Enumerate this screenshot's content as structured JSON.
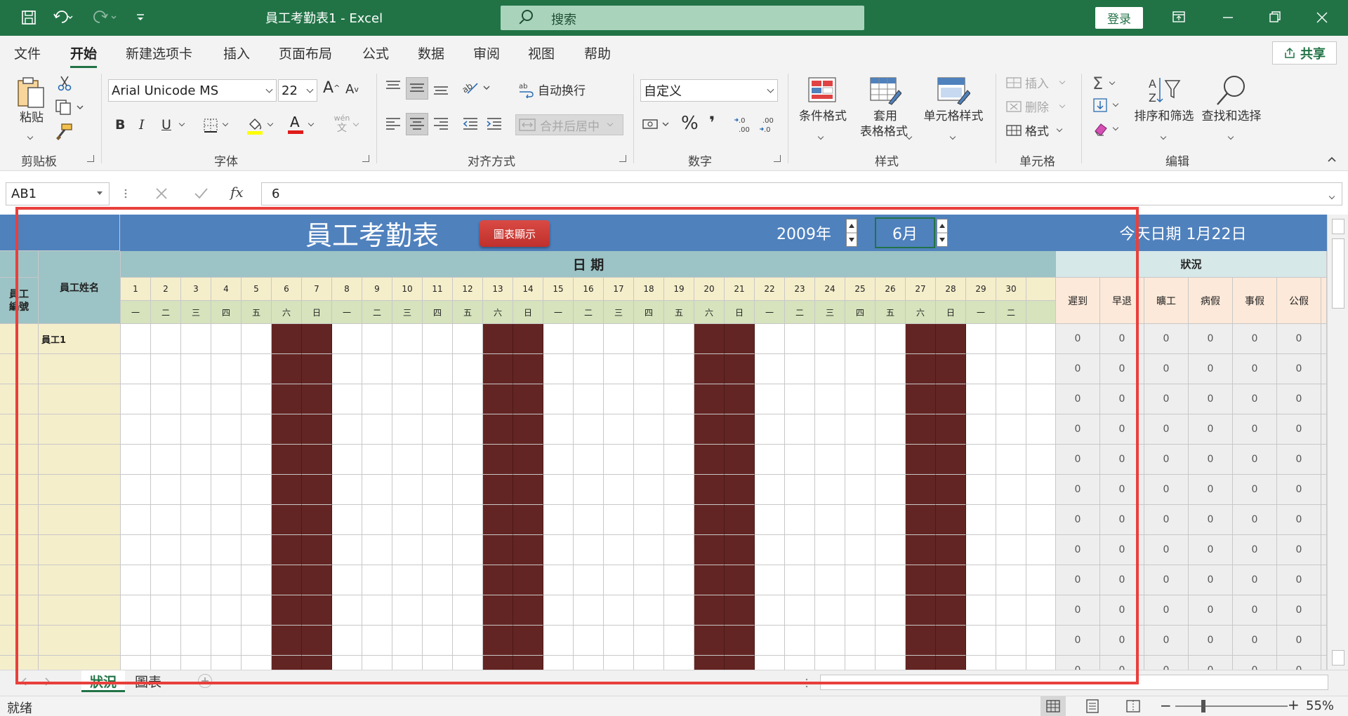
{
  "app": {
    "window_title": "員工考勤表1  -  Excel",
    "search_placeholder": "搜索",
    "login": "登录",
    "share": "共享"
  },
  "tabs": [
    "文件",
    "开始",
    "新建选项卡",
    "插入",
    "页面布局",
    "公式",
    "数据",
    "审阅",
    "视图",
    "帮助"
  ],
  "active_tab": "开始",
  "ribbon": {
    "groups": [
      "剪贴板",
      "字体",
      "对齐方式",
      "数字",
      "样式",
      "单元格",
      "编辑"
    ],
    "paste": "粘贴",
    "font_name": "Arial Unicode MS",
    "font_size": "22",
    "wrap_text": "自动换行",
    "merge_center": "合并后居中",
    "number_format": "自定义",
    "conditional_format": "条件格式",
    "format_table_line1": "套用",
    "format_table_line2": "表格格式",
    "cell_styles": "单元格样式",
    "insert": "插入",
    "delete": "删除",
    "format": "格式",
    "sort_filter": "排序和筛选",
    "find_select": "查找和选择",
    "bold": "B",
    "italic": "I",
    "underline": "U",
    "wen": "wén",
    "wen_sub": "文",
    "percent": "%",
    "comma": "❜"
  },
  "formula_bar": {
    "name_box": "AB1",
    "fx": "fx",
    "value": "6"
  },
  "sheet": {
    "title": "員工考勤表",
    "chart_button": "圖表顯示",
    "year": "2009年",
    "month": "6月",
    "today_label": "今天日期  1月22日",
    "date_header": "日  期",
    "status_header": "狀況",
    "col_emp_id_line1": "員工",
    "col_emp_id_line2": "編號",
    "col_emp_name": "員工姓名",
    "days": [
      "1",
      "2",
      "3",
      "4",
      "5",
      "6",
      "7",
      "8",
      "9",
      "10",
      "11",
      "12",
      "13",
      "14",
      "15",
      "16",
      "17",
      "18",
      "19",
      "20",
      "21",
      "22",
      "23",
      "24",
      "25",
      "26",
      "27",
      "28",
      "29",
      "30"
    ],
    "weekdays": [
      "一",
      "二",
      "三",
      "四",
      "五",
      "六",
      "日",
      "一",
      "二",
      "三",
      "四",
      "五",
      "六",
      "日",
      "一",
      "二",
      "三",
      "四",
      "五",
      "六",
      "日",
      "一",
      "二",
      "三",
      "四",
      "五",
      "六",
      "日",
      "一",
      "二"
    ],
    "weekend_days": [
      6,
      7,
      13,
      14,
      20,
      21,
      27,
      28
    ],
    "status_cols": [
      "遲到",
      "早退",
      "曠工",
      "病假",
      "事假",
      "公假"
    ],
    "first_employee": "員工1",
    "status_value": "0",
    "visible_rows": 12
  },
  "sheet_tabs": [
    "狀況",
    "圖表"
  ],
  "active_sheet": "狀況",
  "status_bar": {
    "ready": "就绪",
    "zoom": "55%"
  },
  "colors": {
    "excel_green": "#217346",
    "title_band": "#4f81bd",
    "header_teal": "#9cc3c5",
    "day_number_bg": "#f5eecb",
    "weekday_bg": "#d6e3bc",
    "weekend": "#632523",
    "name_col_bg": "#f5eecb",
    "status_header_bg": "#fde9d9",
    "status_cell_bg": "#eeeeee",
    "button_red": "#c0302c",
    "highlight": "#e8403c"
  }
}
